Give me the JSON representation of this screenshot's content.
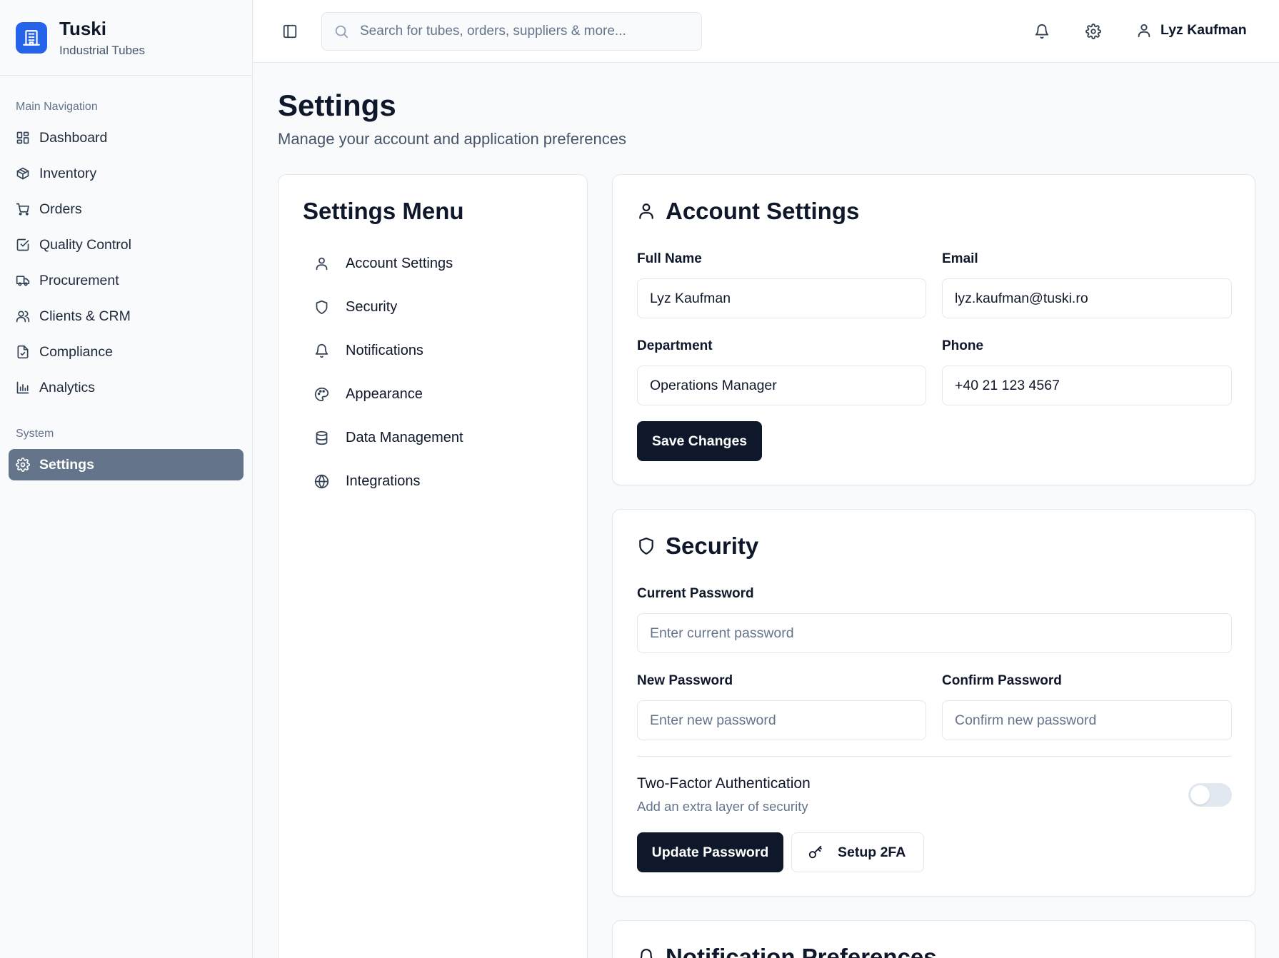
{
  "brand": {
    "title": "Tuski",
    "subtitle": "Industrial Tubes",
    "logo_icon": "building-icon",
    "accent_color": "#2563eb"
  },
  "sidebar": {
    "main_label": "Main Navigation",
    "items": [
      {
        "label": "Dashboard",
        "icon": "dashboard-icon"
      },
      {
        "label": "Inventory",
        "icon": "package-icon"
      },
      {
        "label": "Orders",
        "icon": "cart-icon"
      },
      {
        "label": "Quality Control",
        "icon": "check-square-icon"
      },
      {
        "label": "Procurement",
        "icon": "truck-icon"
      },
      {
        "label": "Clients & CRM",
        "icon": "users-icon"
      },
      {
        "label": "Compliance",
        "icon": "file-check-icon"
      },
      {
        "label": "Analytics",
        "icon": "bar-chart-icon"
      }
    ],
    "system_label": "System",
    "system_items": [
      {
        "label": "Settings",
        "icon": "gear-icon",
        "active": true
      }
    ],
    "active_color": "#64748b"
  },
  "topbar": {
    "search_placeholder": "Search for tubes, orders, suppliers & more...",
    "user_name": "Lyz Kaufman"
  },
  "page": {
    "title": "Settings",
    "subtitle": "Manage your account and application preferences"
  },
  "settings_menu": {
    "title": "Settings Menu",
    "items": [
      {
        "label": "Account Settings",
        "icon": "user-icon"
      },
      {
        "label": "Security",
        "icon": "shield-icon"
      },
      {
        "label": "Notifications",
        "icon": "bell-icon"
      },
      {
        "label": "Appearance",
        "icon": "palette-icon"
      },
      {
        "label": "Data Management",
        "icon": "database-icon"
      },
      {
        "label": "Integrations",
        "icon": "globe-icon"
      }
    ]
  },
  "account": {
    "title": "Account Settings",
    "full_name_label": "Full Name",
    "full_name": "Lyz Kaufman",
    "email_label": "Email",
    "email": "lyz.kaufman@tuski.ro",
    "department_label": "Department",
    "department": "Operations Manager",
    "phone_label": "Phone",
    "phone": "+40 21 123 4567",
    "save_label": "Save Changes"
  },
  "security": {
    "title": "Security",
    "current_password_label": "Current Password",
    "current_password_placeholder": "Enter current password",
    "new_password_label": "New Password",
    "new_password_placeholder": "Enter new password",
    "confirm_password_label": "Confirm Password",
    "confirm_password_placeholder": "Confirm new password",
    "tfa_title": "Two-Factor Authentication",
    "tfa_subtitle": "Add an extra layer of security",
    "tfa_enabled": false,
    "update_label": "Update Password",
    "setup_2fa_label": "Setup 2FA"
  },
  "notifications": {
    "title": "Notification Preferences"
  }
}
